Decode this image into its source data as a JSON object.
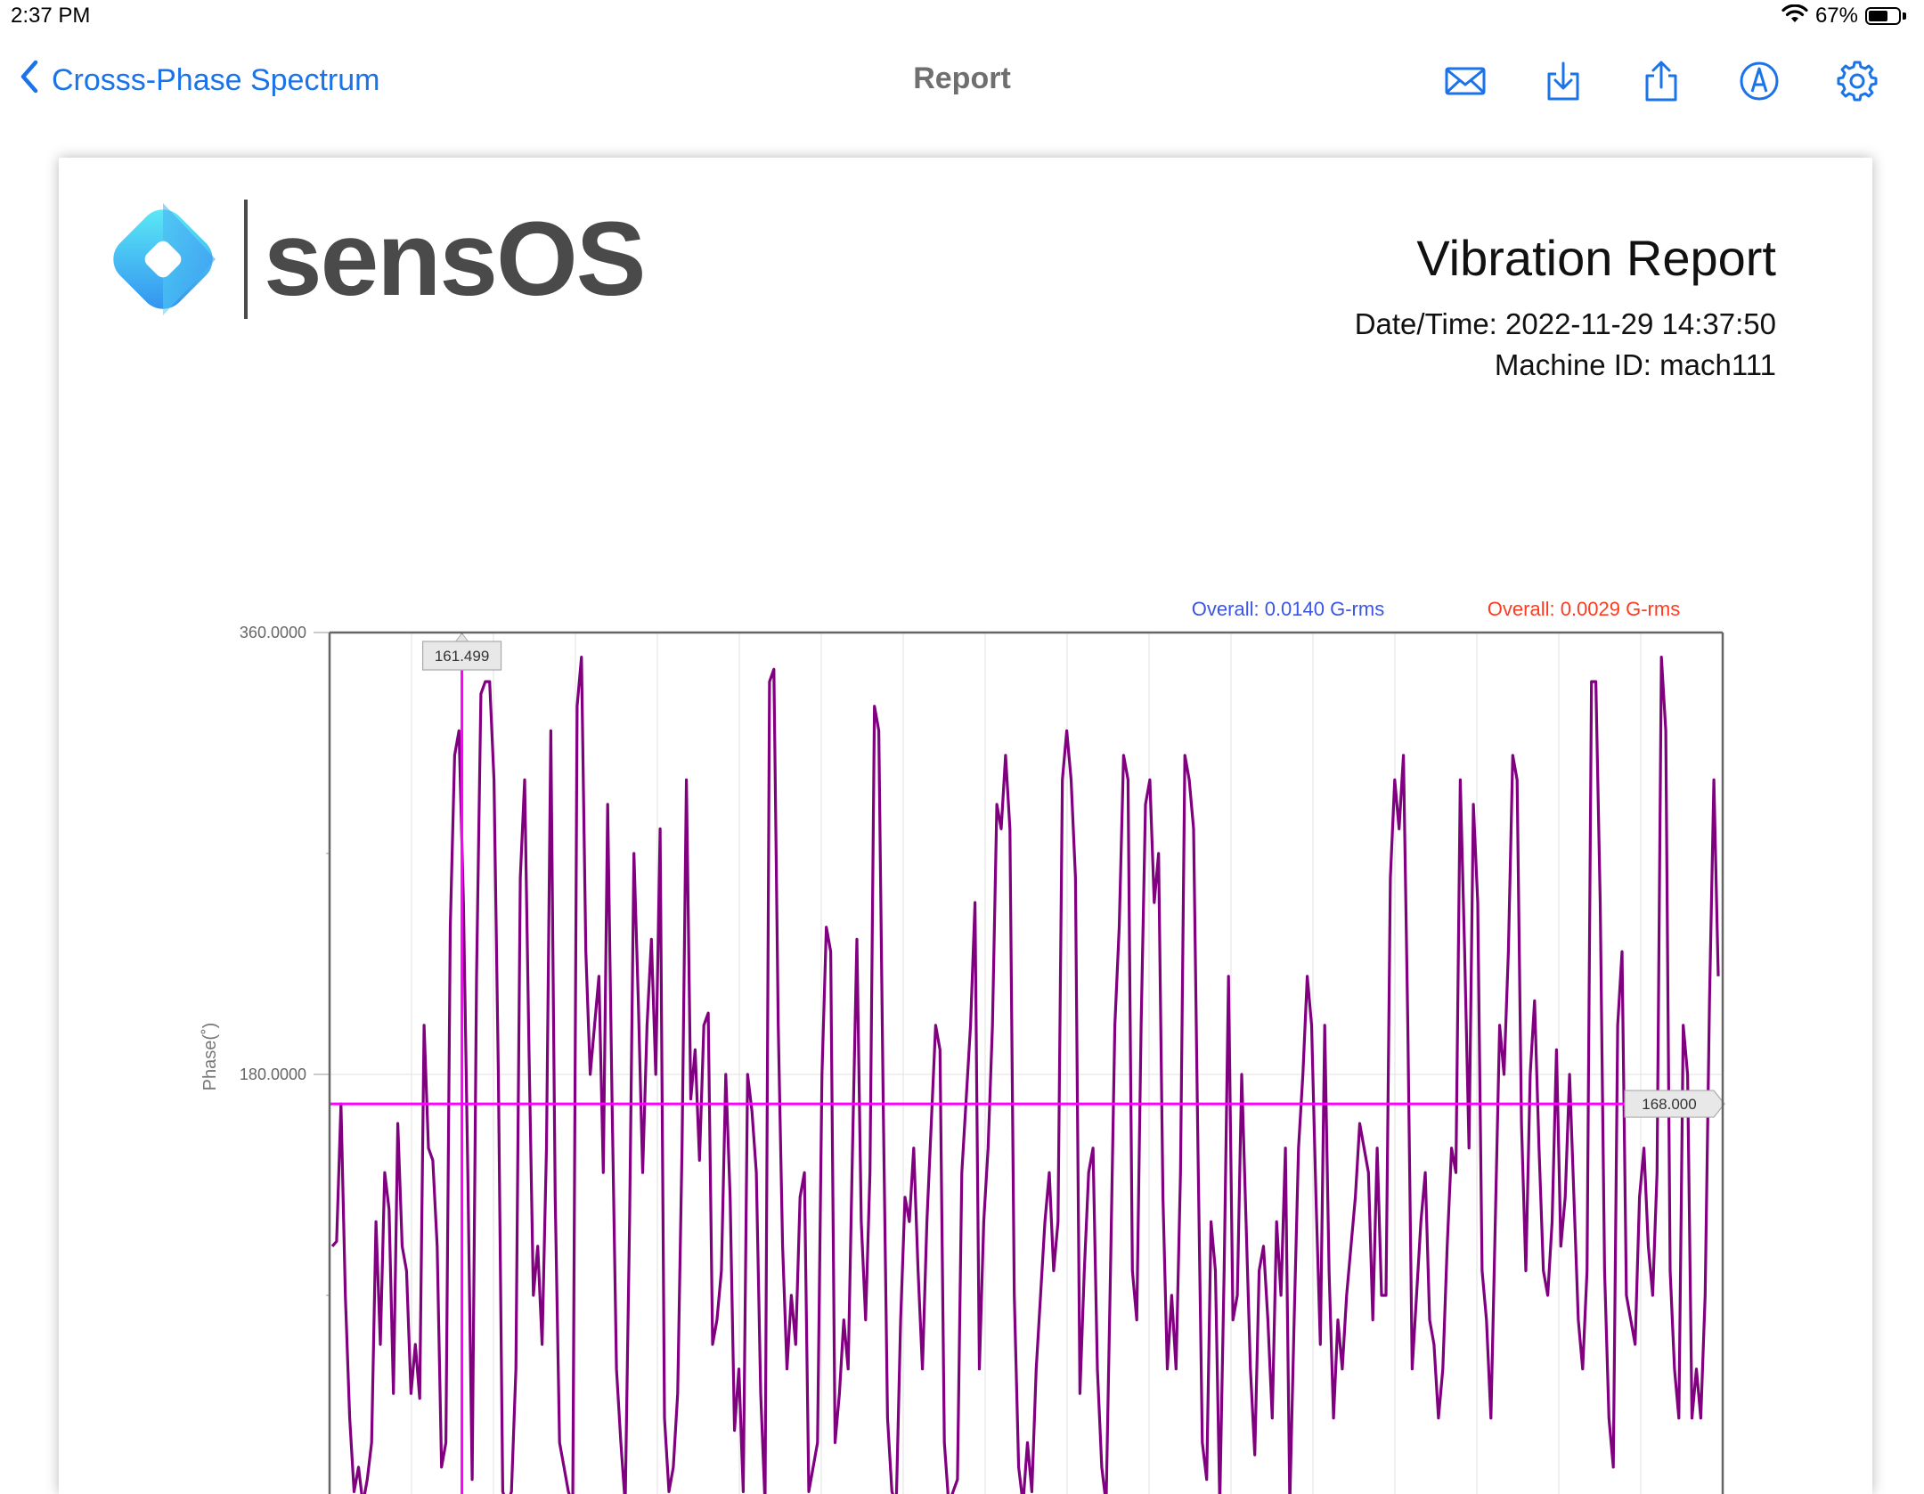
{
  "status_bar": {
    "time": "2:37 PM",
    "battery_percent": "67%",
    "battery_level": 0.67
  },
  "nav": {
    "back_label": "Crosss-Phase Spectrum",
    "title": "Report",
    "actions": [
      "envelope-icon",
      "download-icon",
      "share-icon",
      "markup-icon",
      "gear-icon"
    ],
    "accent_color": "#1a73e8"
  },
  "report": {
    "logo_text": "sensOS",
    "title": "Vibration Report",
    "datetime": "Date/Time: 2022-11-29 14:37:50",
    "machine": "Machine ID: mach111"
  },
  "chart_data": {
    "type": "line",
    "ylabel": "Phase(˚)",
    "y_ticks": [
      "360.0000",
      "180.0000"
    ],
    "ylim": [
      0,
      360
    ],
    "legend": [
      {
        "text": "Overall: 0.0140 G-rms",
        "color": "#3a55e8"
      },
      {
        "text": "Overall: 0.0029 G-rms",
        "color": "#ff3b20"
      }
    ],
    "cursor": {
      "x_label": "161.499",
      "y_label": "168.000",
      "y_value": 168,
      "x_fraction": 0.095
    },
    "series": [
      {
        "color": "#800080",
        "values": [
          110,
          112,
          168,
          90,
          40,
          10,
          20,
          5,
          15,
          30,
          120,
          70,
          140,
          125,
          50,
          160,
          110,
          100,
          50,
          70,
          48,
          200,
          150,
          145,
          110,
          20,
          30,
          240,
          310,
          320,
          250,
          140,
          15,
          220,
          335,
          340,
          340,
          300,
          180,
          10,
          5,
          10,
          60,
          260,
          300,
          190,
          90,
          110,
          70,
          150,
          320,
          130,
          30,
          20,
          10,
          5,
          330,
          350,
          230,
          180,
          200,
          220,
          140,
          290,
          170,
          60,
          30,
          5,
          120,
          270,
          210,
          140,
          200,
          235,
          180,
          280,
          40,
          10,
          20,
          50,
          150,
          300,
          170,
          190,
          145,
          200,
          205,
          70,
          80,
          100,
          180,
          130,
          35,
          60,
          10,
          180,
          165,
          140,
          50,
          5,
          340,
          345,
          200,
          110,
          60,
          90,
          70,
          130,
          140,
          10,
          20,
          30,
          180,
          240,
          230,
          30,
          50,
          80,
          60,
          150,
          235,
          120,
          80,
          140,
          330,
          320,
          170,
          40,
          10,
          5,
          80,
          130,
          120,
          150,
          100,
          60,
          120,
          160,
          200,
          190,
          30,
          5,
          10,
          15,
          140,
          170,
          200,
          250,
          60,
          120,
          150,
          200,
          290,
          280,
          310,
          280,
          90,
          20,
          5,
          30,
          10,
          60,
          90,
          120,
          140,
          100,
          120,
          300,
          320,
          300,
          260,
          50,
          100,
          140,
          150,
          60,
          20,
          5,
          100,
          200,
          240,
          310,
          300,
          100,
          80,
          200,
          290,
          300,
          250,
          270,
          130,
          60,
          90,
          60,
          140,
          310,
          300,
          280,
          150,
          30,
          15,
          120,
          100,
          5,
          100,
          220,
          80,
          90,
          180,
          120,
          60,
          25,
          100,
          110,
          80,
          40,
          120,
          90,
          150,
          5,
          80,
          150,
          180,
          220,
          200,
          130,
          70,
          200,
          100,
          40,
          80,
          60,
          90,
          110,
          130,
          160,
          150,
          140,
          80,
          150,
          90,
          90,
          260,
          300,
          280,
          310,
          200,
          60,
          90,
          120,
          140,
          80,
          70,
          40,
          60,
          110,
          150,
          140,
          300,
          230,
          150,
          290,
          250,
          100,
          80,
          40,
          120,
          200,
          180,
          230,
          310,
          300,
          160,
          100,
          180,
          210,
          150,
          100,
          90,
          120,
          190,
          110,
          130,
          180,
          130,
          80,
          60,
          100,
          340,
          340,
          250,
          100,
          40,
          20,
          200,
          230,
          90,
          80,
          70,
          130,
          150,
          110,
          90,
          140,
          350,
          320,
          100,
          60,
          40,
          200,
          180,
          40,
          60,
          40,
          90,
          210,
          300,
          220
        ]
      }
    ]
  }
}
